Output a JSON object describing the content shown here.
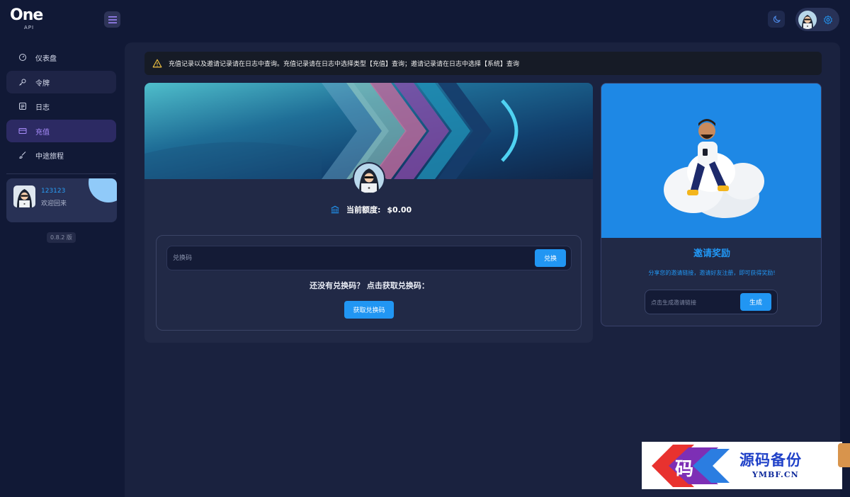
{
  "header": {
    "logo_text": "One",
    "logo_sub": "API"
  },
  "sidebar": {
    "items": [
      {
        "label": "仪表盘",
        "icon": "dashboard-icon"
      },
      {
        "label": "令牌",
        "icon": "key-icon"
      },
      {
        "label": "日志",
        "icon": "log-icon"
      },
      {
        "label": "充值",
        "icon": "credit-card-icon",
        "active": true
      },
      {
        "label": "中途旅程",
        "icon": "brush-icon"
      }
    ],
    "user": {
      "name": "123123",
      "welcome": "欢迎回来"
    },
    "version": "0.8.2 版"
  },
  "alert": {
    "text": "充值记录以及邀请记录请在日志中查询。充值记录请在日志中选择类型【充值】查询；邀请记录请在日志中选择【系统】查询"
  },
  "topup": {
    "quota_label": "当前额度:",
    "quota_value": "$0.00",
    "redeem_placeholder": "兑换码",
    "redeem_button": "兑换",
    "no_code_text": "还没有兑换码？ 点击获取兑换码：",
    "get_code_button": "获取兑换码"
  },
  "invite": {
    "title": "邀请奖励",
    "description": "分享您的邀请链接，邀请好友注册，即可获得奖励!",
    "link_placeholder": "点击生成邀请链接",
    "generate_button": "生成"
  },
  "watermark": {
    "glyph": "码",
    "title": "源码备份",
    "subtitle": "YMBF.CN"
  },
  "colors": {
    "accent": "#2196f3",
    "active_nav": "#a98dfc",
    "background": "#111936",
    "panel": "#212946"
  }
}
